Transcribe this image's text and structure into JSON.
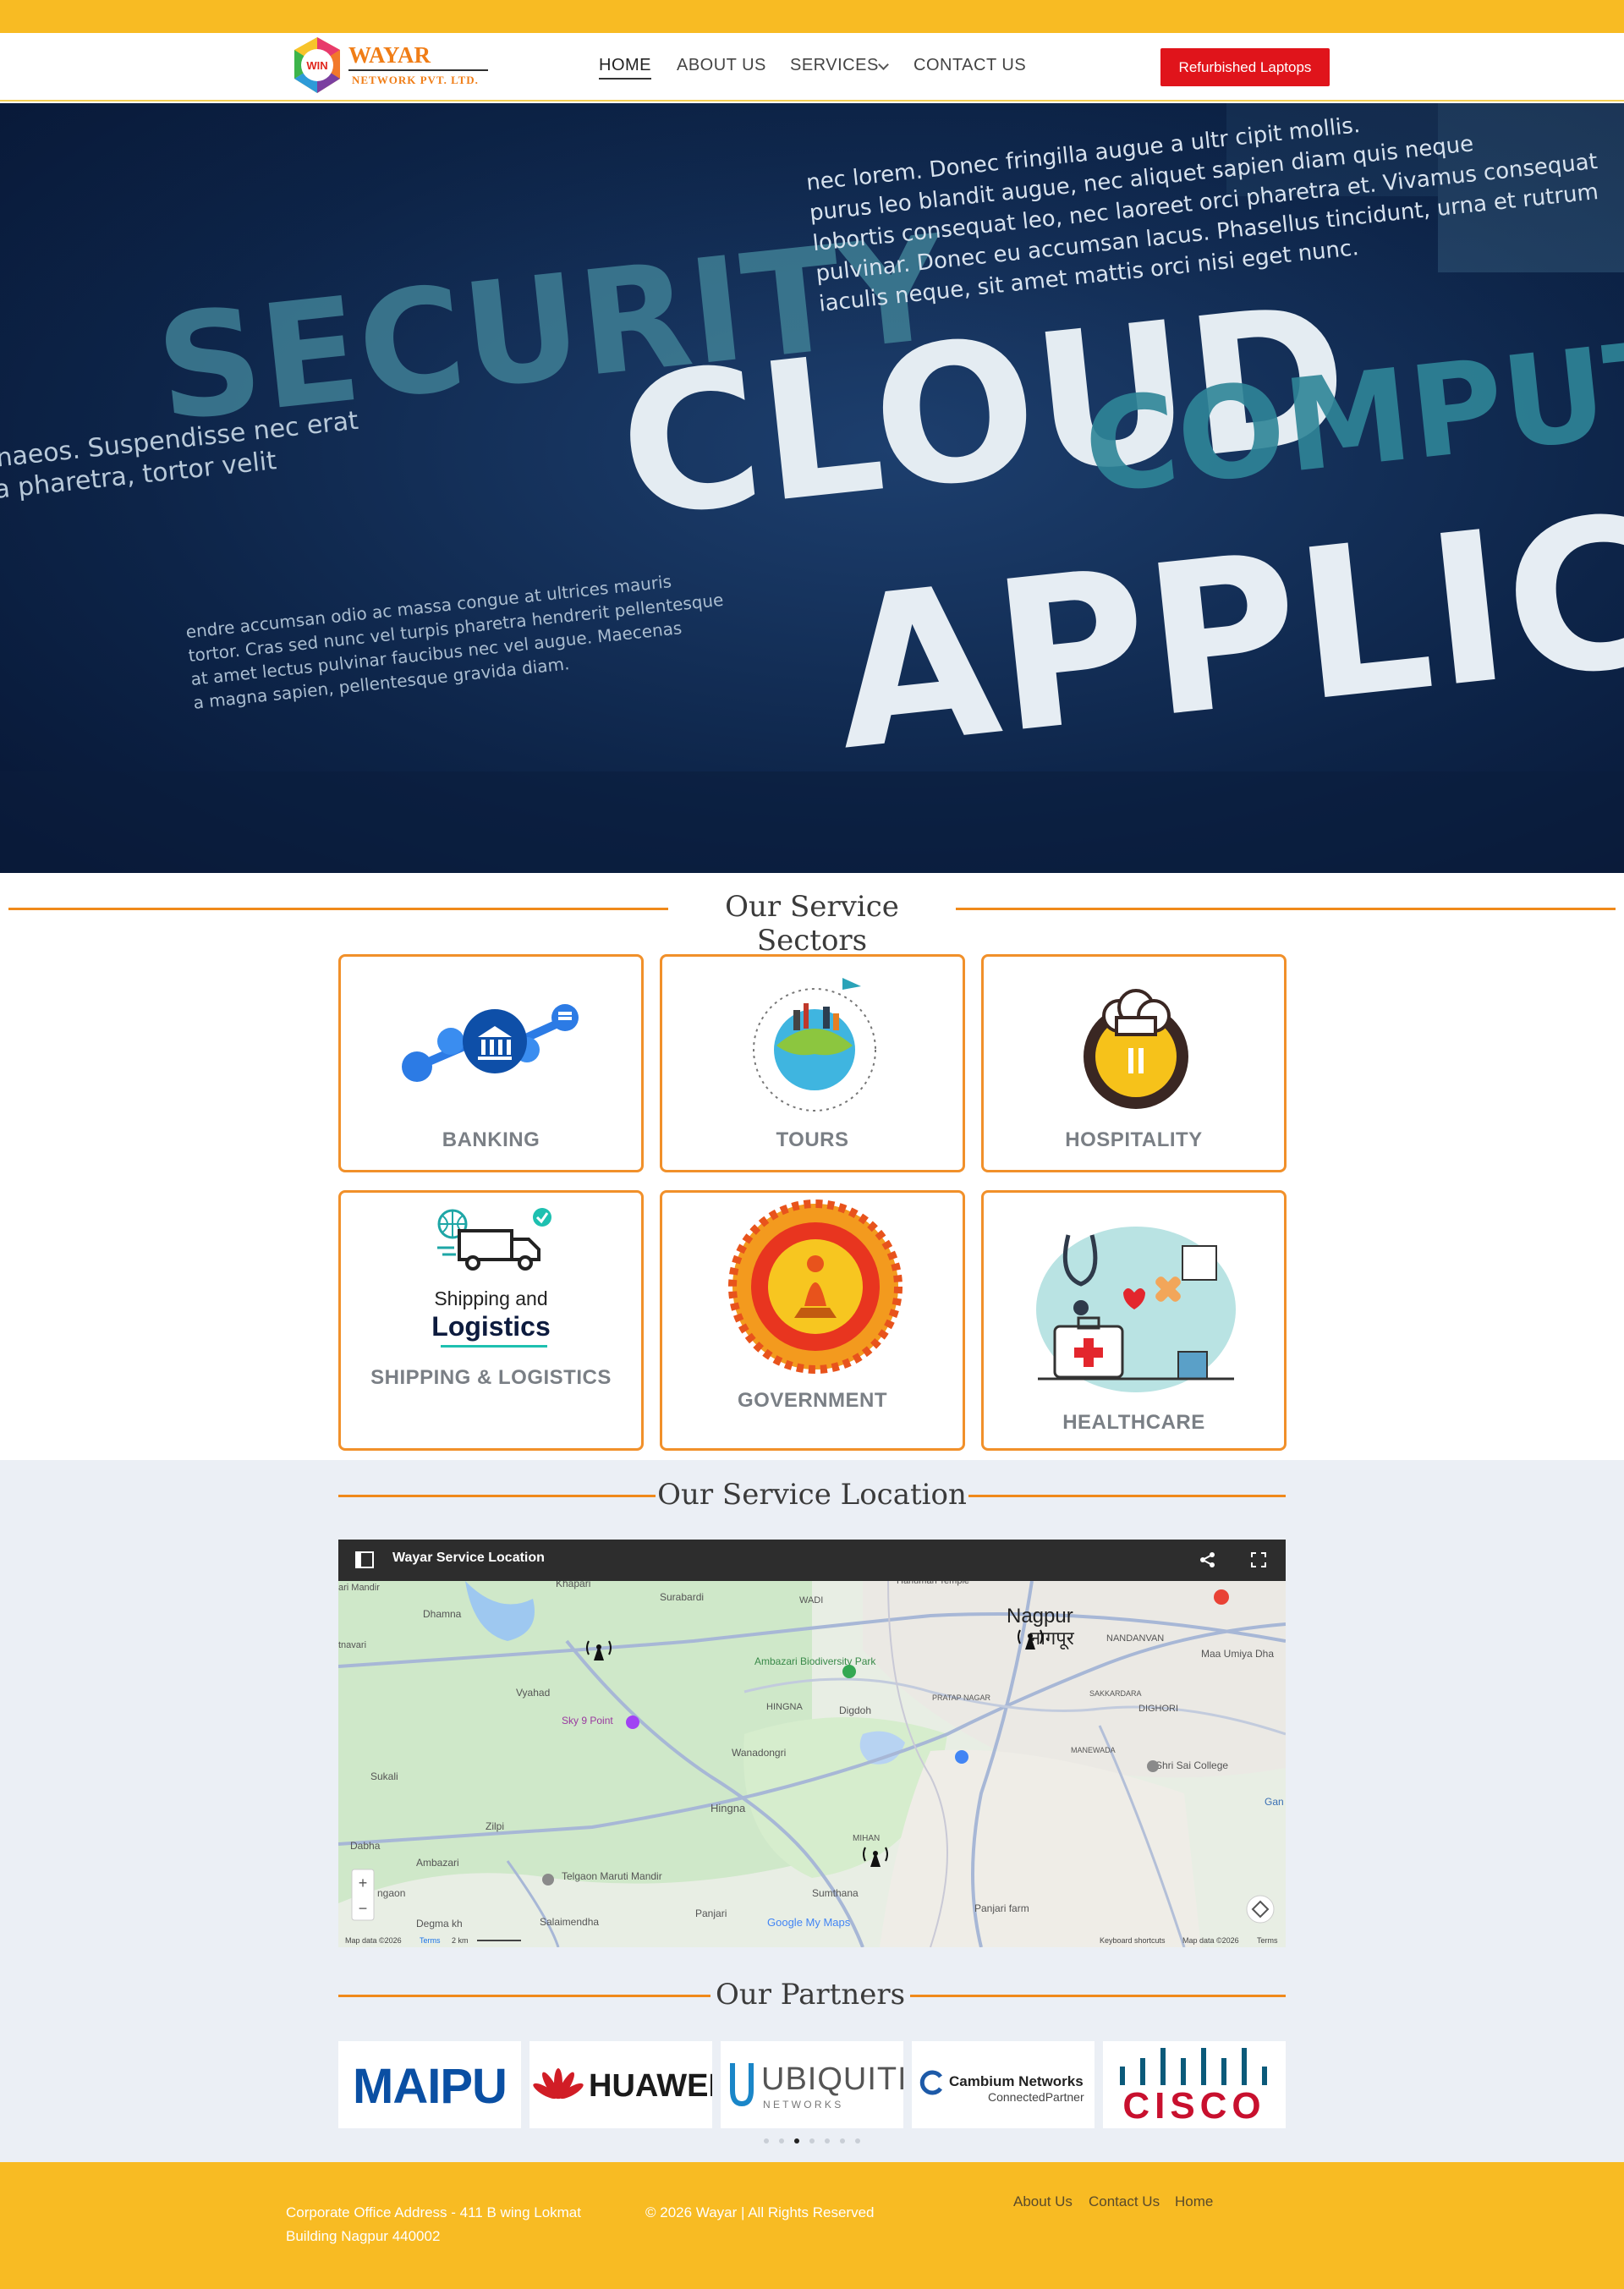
{
  "header": {
    "logo_badge": "WIN",
    "logo_title": "WAYAR",
    "logo_subtitle": "NETWORK PVT. LTD.",
    "nav": {
      "home": "HOME",
      "about": "ABOUT US",
      "services": "SERVICES",
      "contact": "CONTACT US"
    },
    "cta_label": "Refurbished Laptops"
  },
  "hero": {
    "text_security": "SECURITY",
    "text_cloud": "CLOUD",
    "text_computing": "COMPUTING",
    "text_applica": "APPLICA",
    "text_lorem_1": "nec lorem. Donec fringilla augue a ultr  cipit mollis.",
    "text_lorem_2": "purus leo blandit augue, nec aliquet sapien diam quis neque",
    "text_lorem_3": "lobortis consequat leo, nec laoreet orci pharetra et. Vivamus consequat",
    "text_lorem_4": "pulvinar. Donec eu accumsan lacus. Phasellus tincidunt, urna et rutrum",
    "text_lorem_5": "iaculis neque, sit amet mattis orci nisi eget nunc.",
    "text_left_1": "enaeos. Suspendisse nec erat",
    "text_left_2": "ra pharetra, tortor velit",
    "text_mid_1": "endre accumsan odio ac massa congue at ultrices mauris",
    "text_mid_2": "tortor. Cras sed nunc vel turpis pharetra hendrerit pellentesque",
    "text_mid_3": "at amet lectus pulvinar faucibus nec vel augue. Maecenas",
    "text_mid_4": "a magna sapien, pellentesque gravida diam."
  },
  "sectors": {
    "title": "Our Service Sectors",
    "items": [
      {
        "label": "BANKING",
        "icon": "bank-network-icon"
      },
      {
        "label": "TOURS",
        "icon": "globe-travel-icon"
      },
      {
        "label": "HOSPITALITY",
        "icon": "chef-hat-icon"
      },
      {
        "label": "SHIPPING & LOGISTICS",
        "icon": "delivery-truck-icon"
      },
      {
        "label": "GOVERNMENT",
        "icon": "state-emblem-icon"
      },
      {
        "label": "HEALTHCARE",
        "icon": "medical-kit-icon"
      }
    ],
    "logistics_line1": "Shipping and",
    "logistics_line2": "Logistics"
  },
  "location": {
    "title": "Our Service Location",
    "map_title": "Wayar Service Location",
    "places": {
      "nagpur": "Nagpur",
      "nagpur_local": "नागपूर",
      "khapari": "Khapari",
      "surabardi": "Surabardi",
      "wadi": "WADI",
      "dhamna": "Dhamna",
      "ambazari": "Ambazari Biodiversity Park",
      "vyahad": "Vyahad",
      "sky9": "Sky 9 Point",
      "hingna": "HINGNA",
      "digdoh": "Digdoh",
      "pratap_nagar": "PRATAP NAGAR",
      "sakkardara": "SAKKARDARA",
      "nandanvan": "NANDANVAN",
      "dighori": "DIGHORI",
      "manewada": "MANEWADA",
      "maa_umiya": "Maa Umiya Dha",
      "shri_sai": "Shri Sai College",
      "wanadongri": "Wanadongri",
      "hingna2": "Hingna",
      "sukali": "Sukali",
      "zilpi": "Zilpi",
      "dabha": "Dabha",
      "ambazari2": "Ambazari",
      "telgaon": "Telgaon Maruti Mandir",
      "sumthana": "Sumthana",
      "mihan": "MIHAN",
      "panjari": "Panjari",
      "panjari_farm": "Panjari farm",
      "degma": "Degma kh",
      "salaimendha": "Salaimendha",
      "ingaon": "ngaon",
      "kali_mandir": "ari Mandir",
      "tnavari": "tnavari",
      "hanuman": "Hanuman Temple",
      "gan": "Gan"
    },
    "google_label": "Google My Maps",
    "map_data": "Map data ©2026",
    "terms": "Terms",
    "scale": "2 km",
    "keyboard": "Keyboard shortcuts",
    "map_data_right": "Map data ©2026",
    "terms_right": "Terms",
    "zoom_in": "+",
    "zoom_out": "−"
  },
  "partners": {
    "title": "Our Partners",
    "items": [
      "MAIPU",
      "HUAWEI",
      "UBIQUITI",
      "Cambium Networks",
      "CISCO"
    ],
    "ubiquiti_sub": "N E T W O R K S",
    "cambium_sub": "ConnectedPartner",
    "active_page": 3
  },
  "footer": {
    "address_line1": "Corporate Office Address - 411 B wing Lokmat",
    "address_line2": "Building Nagpur 440002",
    "copyright": "© 2026 Wayar | All Rights Reserved",
    "links": [
      "About Us",
      "Contact Us",
      "Home"
    ]
  },
  "colors": {
    "brand_yellow": "#f8bb23",
    "accent_orange": "#f0891a",
    "cta_red": "#e0141b"
  }
}
